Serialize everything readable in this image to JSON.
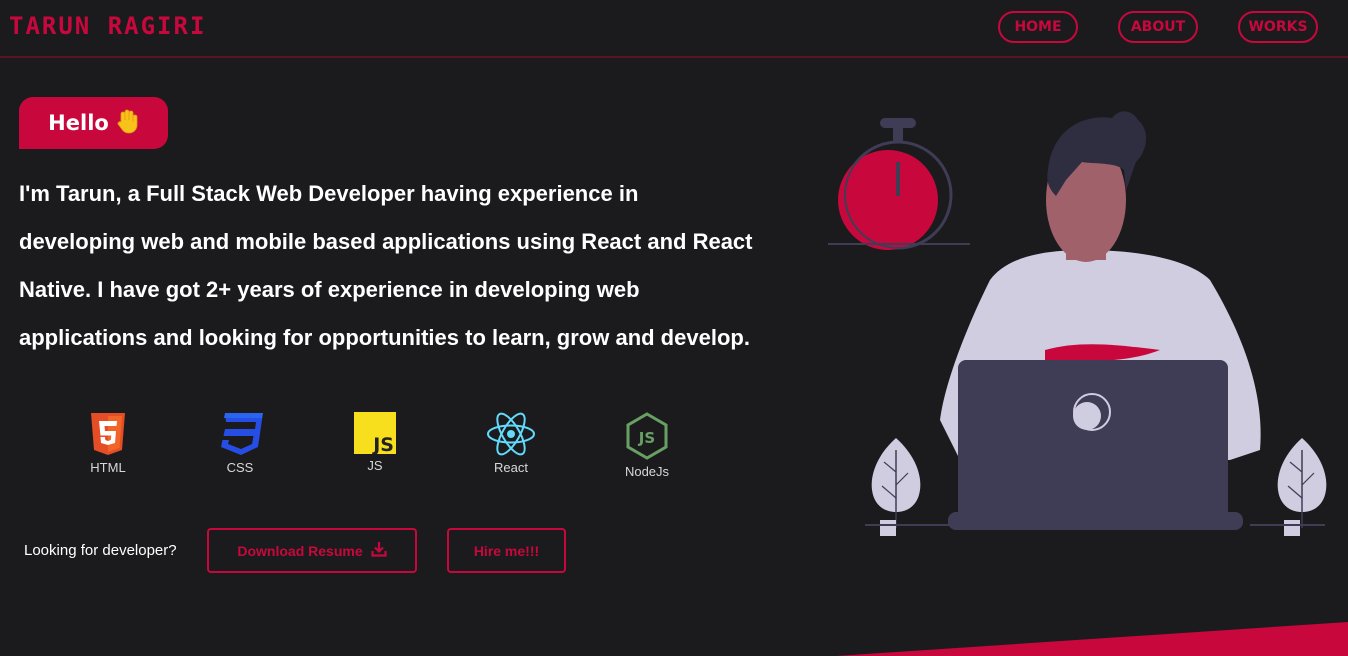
{
  "header": {
    "brand": "TARUN RAGIRI",
    "nav": [
      {
        "label": "HOME"
      },
      {
        "label": "ABOUT"
      },
      {
        "label": "WORKS"
      }
    ]
  },
  "hero": {
    "greeting": "Hello",
    "greeting_icon": "waving-hand-icon",
    "intro": "I'm Tarun, a Full Stack Web Developer having experience in developing web and mobile based applications using React and React Native. I have got 2+ years of experience in developing web applications and looking for opportunities to learn, grow and develop.",
    "skills": [
      {
        "label": "HTML",
        "icon": "html5-icon"
      },
      {
        "label": "CSS",
        "icon": "css3-icon"
      },
      {
        "label": "JS",
        "icon": "javascript-icon"
      },
      {
        "label": "React",
        "icon": "react-icon"
      },
      {
        "label": "NodeJs",
        "icon": "nodejs-icon"
      }
    ],
    "cta_prompt": "Looking for developer?",
    "download_label": "Download Resume",
    "hire_label": "Hire me!!!"
  },
  "colors": {
    "background": "#1b1b1e",
    "accent": "#c8083d",
    "text": "#ffffff"
  }
}
